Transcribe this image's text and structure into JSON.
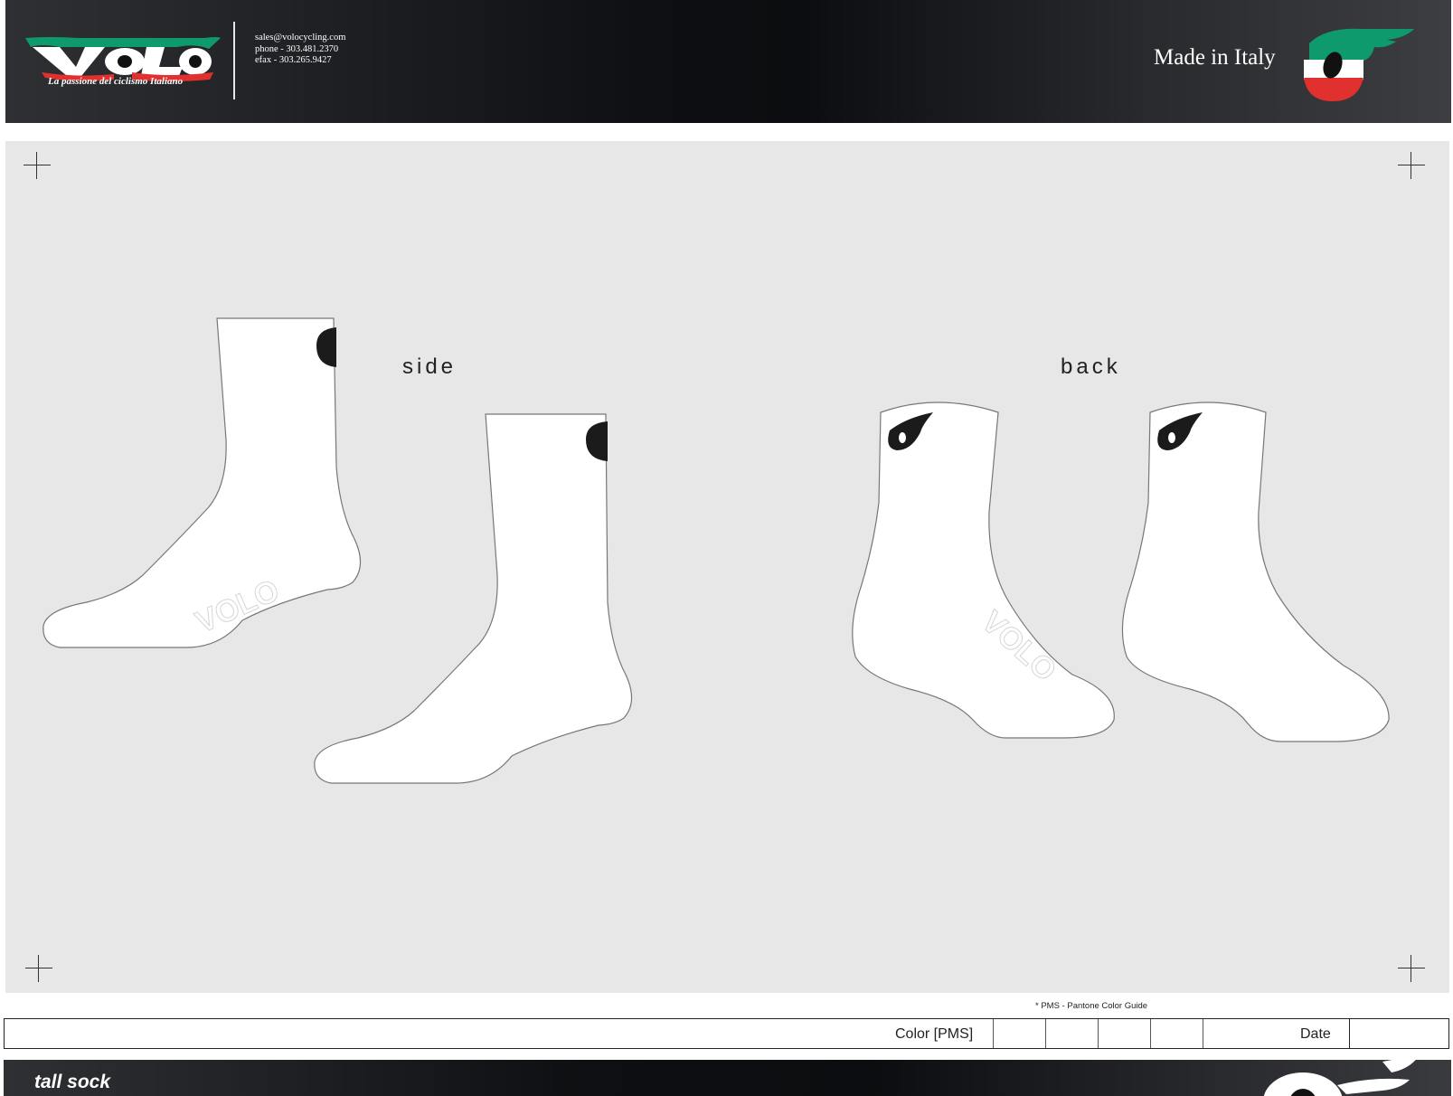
{
  "header": {
    "brand": "VOLO",
    "tagline": "La passione del ciclismo Italiano",
    "email": "sales@volocycling.com",
    "phone": "phone - 303.481.2370",
    "efax": "efax - 303.265.9427",
    "made_in": "Made in Italy"
  },
  "views": {
    "side_label": "side",
    "back_label": "back",
    "sole_logo_text": "VOLO"
  },
  "colors": {
    "italy_green": "#0f9a6d",
    "italy_red": "#e0312f",
    "artboard": "#e7e7e8",
    "header_dark": "#0d0f12"
  },
  "footer": {
    "pms_note": "* PMS - Pantone Color Guide",
    "color_label": "Color [PMS]",
    "date_label": "Date",
    "product_name": "tall sock"
  }
}
